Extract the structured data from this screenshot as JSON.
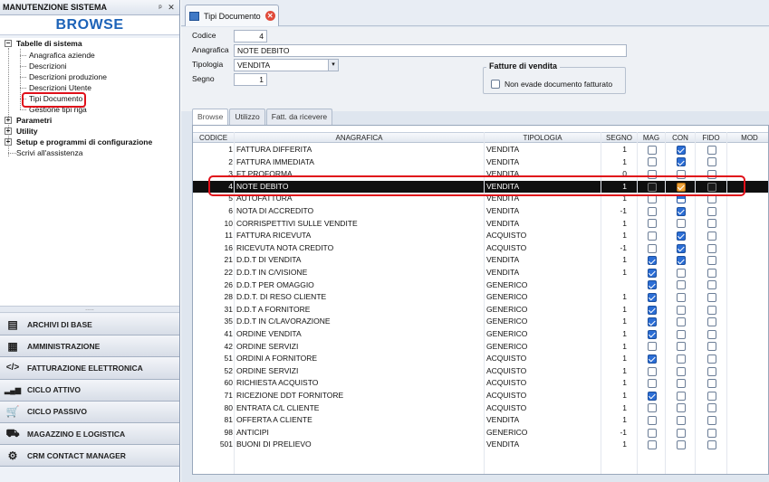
{
  "left_panel": {
    "title": "MANUTENZIONE SISTEMA",
    "pin_icon": "ᵖ",
    "close_icon": "✕",
    "browse_label": "BROWSE",
    "tree": {
      "tabelle": "Tabelle di sistema",
      "items": [
        "Anagrafica aziende",
        "Descrizioni",
        "Descrizioni produzione",
        "Descrizioni Utente",
        "Tipi Documento",
        "Gestione tipi riga"
      ],
      "parametri": "Parametri",
      "utility": "Utility",
      "setup": "Setup e programmi di configurazione",
      "scrivi": "Scrivi all'assistenza"
    },
    "modules": [
      {
        "label": "ARCHIVI DI BASE",
        "icon": "database-icon",
        "glyph": "▤"
      },
      {
        "label": "AMMINISTRAZIONE",
        "icon": "calculator-icon",
        "glyph": "▦"
      },
      {
        "label": "FATTURAZIONE ELETTRONICA",
        "icon": "code-icon",
        "glyph": "</>"
      },
      {
        "label": "CICLO ATTIVO",
        "icon": "bar-chart-icon",
        "glyph": "▂▄▆"
      },
      {
        "label": "CICLO PASSIVO",
        "icon": "cart-icon",
        "glyph": "🛒"
      },
      {
        "label": "MAGAZZINO E LOGISTICA",
        "icon": "forklift-icon",
        "glyph": "⛟"
      },
      {
        "label": "CRM CONTACT MANAGER",
        "icon": "handshake-icon",
        "glyph": "⚙"
      }
    ]
  },
  "tab": {
    "label": "Tipi Documento",
    "close_glyph": "✕"
  },
  "form": {
    "codice_label": "Codice",
    "codice_value": "4",
    "anagrafica_label": "Anagrafica",
    "anagrafica_value": "NOTE DEBITO",
    "tipologia_label": "Tipologia",
    "tipologia_value": "VENDITA",
    "dropdown_glyph": "▾",
    "segno_label": "Segno",
    "segno_value": "1",
    "group_title": "Fatture di vendita",
    "non_evade_label": "Non evade documento fatturato"
  },
  "subtabs": [
    "Browse",
    "Utilizzo",
    "Fatt. da ricevere"
  ],
  "columns": [
    "CODICE",
    "ANAGRAFICA",
    "TIPOLOGIA",
    "SEGNO",
    "MAG",
    "CON",
    "FIDO",
    "MOD"
  ],
  "rows": [
    {
      "codice": "1",
      "anagrafica": "FATTURA DIFFERITA",
      "tipologia": "VENDITA",
      "segno": "1",
      "mag": "off",
      "con": "on",
      "fido": "off"
    },
    {
      "codice": "2",
      "anagrafica": "FATTURA IMMEDIATA",
      "tipologia": "VENDITA",
      "segno": "1",
      "mag": "off",
      "con": "on",
      "fido": "off"
    },
    {
      "codice": "3",
      "anagrafica": "FT PROFORMA",
      "tipologia": "VENDITA",
      "segno": "0",
      "mag": "off",
      "con": "off",
      "fido": "off"
    },
    {
      "codice": "4",
      "anagrafica": "NOTE DEBITO",
      "tipologia": "VENDITA",
      "segno": "1",
      "mag": "dark",
      "con": "orange",
      "fido": "dark",
      "selected": true
    },
    {
      "codice": "5",
      "anagrafica": "AUTOFATTURA",
      "tipologia": "VENDITA",
      "segno": "1",
      "mag": "off",
      "con": "half",
      "fido": "off"
    },
    {
      "codice": "6",
      "anagrafica": "NOTA DI ACCREDITO",
      "tipologia": "VENDITA",
      "segno": "-1",
      "mag": "off",
      "con": "on",
      "fido": "off"
    },
    {
      "codice": "10",
      "anagrafica": "CORRISPETTIVI SULLE VENDITE",
      "tipologia": "VENDITA",
      "segno": "1",
      "mag": "off",
      "con": "off",
      "fido": "off"
    },
    {
      "codice": "11",
      "anagrafica": "FATTURA RICEVUTA",
      "tipologia": "ACQUISTO",
      "segno": "1",
      "mag": "off",
      "con": "on",
      "fido": "off"
    },
    {
      "codice": "16",
      "anagrafica": "RICEVUTA NOTA CREDITO",
      "tipologia": "ACQUISTO",
      "segno": "-1",
      "mag": "off",
      "con": "on",
      "fido": "off"
    },
    {
      "codice": "21",
      "anagrafica": "D.D.T DI VENDITA",
      "tipologia": "VENDITA",
      "segno": "1",
      "mag": "on",
      "con": "on",
      "fido": "off"
    },
    {
      "codice": "22",
      "anagrafica": "D.D.T IN C/VISIONE",
      "tipologia": "VENDITA",
      "segno": "1",
      "mag": "on",
      "con": "off",
      "fido": "off"
    },
    {
      "codice": "26",
      "anagrafica": "D.D.T PER OMAGGIO",
      "tipologia": "GENERICO",
      "segno": "",
      "mag": "on",
      "con": "off",
      "fido": "off"
    },
    {
      "codice": "28",
      "anagrafica": "D.D.T. DI RESO CLIENTE",
      "tipologia": "GENERICO",
      "segno": "1",
      "mag": "on",
      "con": "off",
      "fido": "off"
    },
    {
      "codice": "31",
      "anagrafica": "D.D.T A FORNITORE",
      "tipologia": "GENERICO",
      "segno": "1",
      "mag": "on",
      "con": "off",
      "fido": "off"
    },
    {
      "codice": "35",
      "anagrafica": "D.D.T IN C/LAVORAZIONE",
      "tipologia": "GENERICO",
      "segno": "1",
      "mag": "on",
      "con": "off",
      "fido": "off"
    },
    {
      "codice": "41",
      "anagrafica": "ORDINE VENDITA",
      "tipologia": "GENERICO",
      "segno": "1",
      "mag": "on",
      "con": "off",
      "fido": "off"
    },
    {
      "codice": "42",
      "anagrafica": "ORDINE SERVIZI",
      "tipologia": "GENERICO",
      "segno": "1",
      "mag": "off",
      "con": "off",
      "fido": "off"
    },
    {
      "codice": "51",
      "anagrafica": "ORDINI A FORNITORE",
      "tipologia": "ACQUISTO",
      "segno": "1",
      "mag": "on",
      "con": "off",
      "fido": "off"
    },
    {
      "codice": "52",
      "anagrafica": "ORDINE SERVIZI",
      "tipologia": "ACQUISTO",
      "segno": "1",
      "mag": "off",
      "con": "off",
      "fido": "off"
    },
    {
      "codice": "60",
      "anagrafica": "RICHIESTA ACQUISTO",
      "tipologia": "ACQUISTO",
      "segno": "1",
      "mag": "off",
      "con": "off",
      "fido": "off"
    },
    {
      "codice": "71",
      "anagrafica": "RICEZIONE DDT FORNITORE",
      "tipologia": "ACQUISTO",
      "segno": "1",
      "mag": "on",
      "con": "off",
      "fido": "off"
    },
    {
      "codice": "80",
      "anagrafica": "ENTRATA C/L CLIENTE",
      "tipologia": "ACQUISTO",
      "segno": "1",
      "mag": "off",
      "con": "off",
      "fido": "off"
    },
    {
      "codice": "81",
      "anagrafica": "OFFERTA A CLIENTE",
      "tipologia": "VENDITA",
      "segno": "1",
      "mag": "off",
      "con": "off",
      "fido": "off"
    },
    {
      "codice": "98",
      "anagrafica": "ANTICIPI",
      "tipologia": "GENERICO",
      "segno": "-1",
      "mag": "off",
      "con": "off",
      "fido": "off"
    },
    {
      "codice": "501",
      "anagrafica": "BUONI DI PRELIEVO",
      "tipologia": "VENDITA",
      "segno": "1",
      "mag": "off",
      "con": "off",
      "fido": "off"
    }
  ],
  "colors": {
    "accent_blue": "#1d63b8",
    "highlight_red": "#e0101a",
    "selected_row": "#0f0f0f",
    "checkbox_on": "#2c6ed5",
    "checkbox_orange": "#f0a33a"
  }
}
